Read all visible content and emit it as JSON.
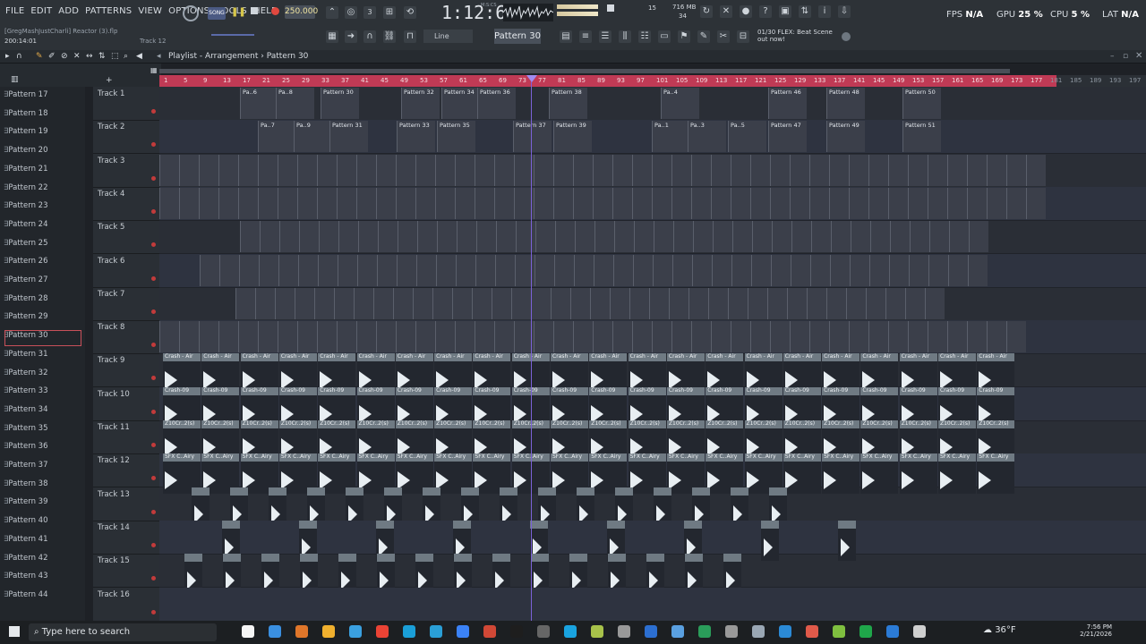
{
  "menu": [
    "FILE",
    "EDIT",
    "ADD",
    "PATTERNS",
    "VIEW",
    "OPTIONS",
    "TOOLS",
    "HELP"
  ],
  "project": {
    "file_hint": "[GregMashJustCharli] Reactor (3).flp",
    "time_small": "200:14:01",
    "track_hint": "Track 12"
  },
  "transport": {
    "mode": "SONG",
    "tempo": "250.000",
    "time": "1:12:62",
    "time_unit": "M:S:CS",
    "memory": "716 MB",
    "cpu_count": "34",
    "voices": "15"
  },
  "toolbar": {
    "snap": "Line",
    "pattern": "Pattern 30",
    "news": "01/30  FLEX: Beat Scene out now!"
  },
  "stats": {
    "fps_label": "FPS",
    "fps": "N/A",
    "gpu_label": "GPU",
    "gpu": "25 %",
    "cpu_label": "CPU",
    "cpu": "5 %",
    "lat_label": "LAT",
    "lat": "N/A"
  },
  "playlist": {
    "title": "Playlist - Arrangement",
    "current": "Pattern 30"
  },
  "ruler": [
    "1",
    "5",
    "9",
    "13",
    "17",
    "21",
    "25",
    "29",
    "33",
    "37",
    "41",
    "45",
    "49",
    "53",
    "57",
    "61",
    "65",
    "69",
    "73",
    "77",
    "81",
    "85",
    "89",
    "93",
    "97",
    "101",
    "105",
    "109",
    "113",
    "117",
    "121",
    "125",
    "129",
    "133",
    "137",
    "141",
    "145",
    "149",
    "153",
    "157",
    "161",
    "165",
    "169",
    "173",
    "177",
    "181",
    "185",
    "189",
    "193",
    "197"
  ],
  "patterns": [
    "Pattern 17",
    "Pattern 18",
    "Pattern 19",
    "Pattern 20",
    "Pattern 21",
    "Pattern 22",
    "Pattern 23",
    "Pattern 24",
    "Pattern 25",
    "Pattern 26",
    "Pattern 27",
    "Pattern 28",
    "Pattern 29",
    "Pattern 30",
    "Pattern 31",
    "Pattern 32",
    "Pattern 33",
    "Pattern 34",
    "Pattern 35",
    "Pattern 36",
    "Pattern 37",
    "Pattern 38",
    "Pattern 39",
    "Pattern 40",
    "Pattern 41",
    "Pattern 42",
    "Pattern 43",
    "Pattern 44"
  ],
  "selected_pattern": "Pattern 30",
  "tracks": [
    "Track 1",
    "Track 2",
    "Track 3",
    "Track 4",
    "Track 5",
    "Track 6",
    "Track 7",
    "Track 8",
    "Track 9",
    "Track 10",
    "Track 11",
    "Track 12",
    "Track 13",
    "Track 14",
    "Track 15",
    "Track 16"
  ],
  "clip_labels": {
    "t1": [
      "Pa..6",
      "Pa..8",
      "Pattern 30",
      "Pattern 32",
      "Pattern 34",
      "Pattern 36",
      "Pattern 38",
      "Pa..4",
      "Pattern 46",
      "Pattern 48",
      "Pattern 50"
    ],
    "t2": [
      "Pa..7",
      "Pa..9",
      "Pattern 31",
      "Pattern 33",
      "Pattern 35",
      "Pattern 37",
      "Pattern 39",
      "Pa..1",
      "Pa..3",
      "Pa..5",
      "Pattern 47",
      "Pattern 49",
      "Pattern 51"
    ],
    "t9": "Crash - Air",
    "t10": "Crash-09",
    "t11": "Z10Cr..2(s)",
    "t12": "SFX C..Airy"
  },
  "taskbar": {
    "search_placeholder": "Type here to search",
    "weather": "36°F",
    "time": "7:56 PM",
    "date": "2/21/2026"
  },
  "colors": {
    "ruler": "#c03a55",
    "playhead": "#7b62d8",
    "audio_header": "#6f7a83"
  }
}
